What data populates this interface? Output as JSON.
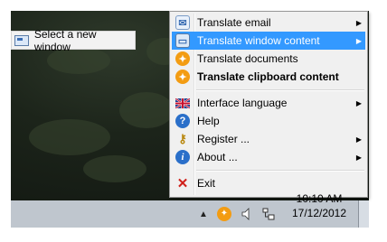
{
  "submenu": {
    "select_window": "Select a new window"
  },
  "menu": {
    "items": [
      {
        "label": "Translate email",
        "icon": "email-icon",
        "has_submenu": true
      },
      {
        "label": "Translate window content",
        "icon": "window-icon",
        "has_submenu": true,
        "highlighted": true
      },
      {
        "label": "Translate documents",
        "icon": "documents-icon",
        "has_submenu": false
      },
      {
        "label": "Translate clipboard content",
        "icon": "clipboard-icon",
        "has_submenu": false,
        "bold": true
      },
      {
        "label": "Interface language",
        "icon": "uk-flag-icon",
        "has_submenu": true
      },
      {
        "label": "Help",
        "icon": "help-icon",
        "has_submenu": false
      },
      {
        "label": "Register ...",
        "icon": "keys-icon",
        "has_submenu": true
      },
      {
        "label": "About ...",
        "icon": "info-icon",
        "has_submenu": true
      },
      {
        "label": "Exit",
        "icon": "exit-x-icon",
        "has_submenu": false
      }
    ]
  },
  "tray": {
    "time": "10:10 AM",
    "date": "17/12/2012"
  },
  "colors": {
    "highlight": "#3399ff",
    "menu_bg": "#f0f0f0"
  }
}
